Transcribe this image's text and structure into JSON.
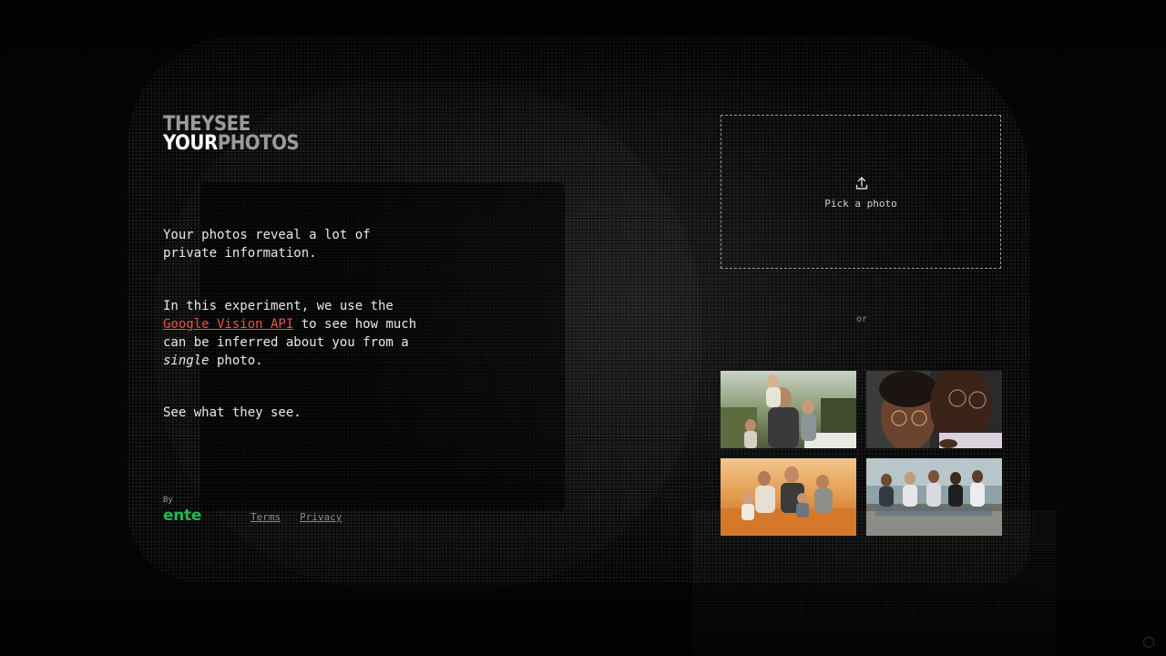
{
  "logo": {
    "line1": "THEYSEE",
    "line2_bright": "YOUR",
    "line2_dim": "PHOTOS"
  },
  "intro": {
    "p1": "Your photos reveal a lot of private information.",
    "p2_before": "In this experiment, we use the ",
    "p2_link": "Google Vision API",
    "p2_mid": " to see how much can be inferred about you from a ",
    "p2_em": "single",
    "p2_after": " photo.",
    "p3": "See what they see."
  },
  "footer": {
    "by_label": "By",
    "brand": "ente",
    "terms": "Terms",
    "privacy": "Privacy"
  },
  "upload": {
    "label": "Pick a photo",
    "icon": "upload-icon",
    "or_label": "or"
  },
  "colors": {
    "link": "#e2574c",
    "brand": "#1db954",
    "background": "#050505"
  }
}
